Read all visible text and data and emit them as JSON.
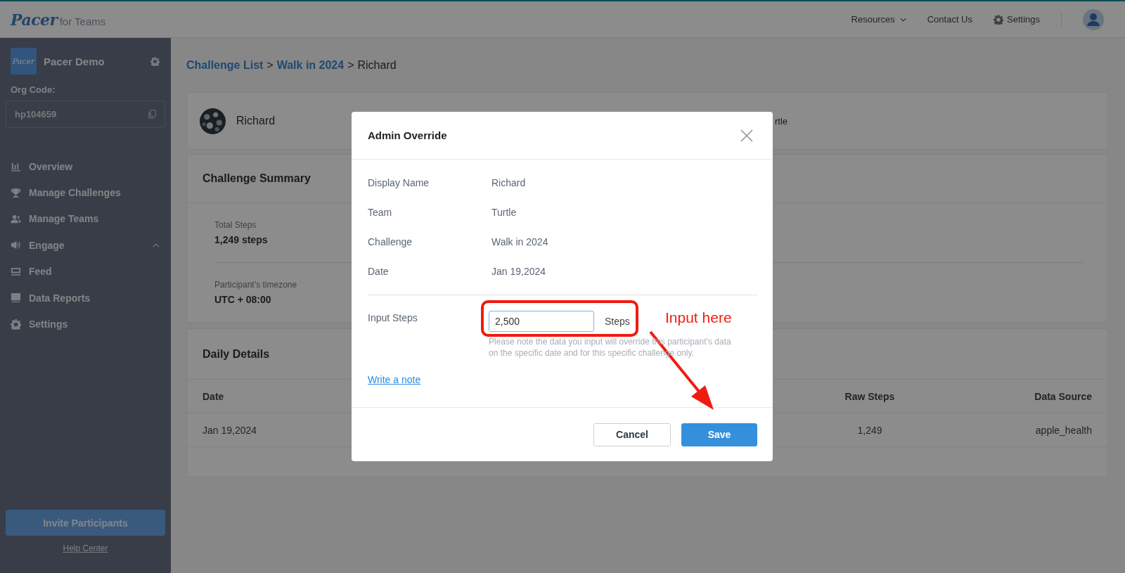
{
  "header": {
    "logo": "Pacer",
    "logo_suffix": "for Teams",
    "nav": [
      {
        "label": "Resources",
        "kind": "dropdown"
      },
      {
        "label": "Contact Us",
        "kind": "link"
      },
      {
        "label": "Settings",
        "kind": "settings"
      }
    ]
  },
  "sidebar": {
    "org_logo": "Pacer",
    "org_name": "Pacer Demo",
    "org_code_label": "Org Code:",
    "org_code": "hp104659",
    "items": [
      {
        "label": "Overview"
      },
      {
        "label": "Manage Challenges"
      },
      {
        "label": "Manage Teams"
      },
      {
        "label": "Engage",
        "expanded": true
      },
      {
        "label": "Feed"
      },
      {
        "label": "Data Reports"
      },
      {
        "label": "Settings"
      }
    ],
    "invite_button": "Invite Participants",
    "help_link": "Help Center"
  },
  "breadcrumb": [
    {
      "text": "Challenge List",
      "kind": "link"
    },
    {
      "text": ">",
      "kind": "separator"
    },
    {
      "text": "Walk in 2024",
      "kind": "link"
    },
    {
      "text": ">",
      "kind": "separator"
    },
    {
      "text": "Richard",
      "kind": "current"
    }
  ],
  "profile": {
    "name": "Richard",
    "team": "rtle"
  },
  "summary": {
    "title": "Challenge Summary",
    "stats": [
      {
        "label": "Total Steps",
        "value": "1,249 steps"
      },
      {
        "label": "Participant’s timezone",
        "value": "UTC + 08:00"
      }
    ]
  },
  "daily": {
    "title": "Daily Details",
    "columns": [
      "Date",
      "Raw Steps",
      "Data Source"
    ],
    "rows": [
      [
        "Jan 19,2024",
        "1,249",
        "apple_health"
      ]
    ]
  },
  "modal": {
    "title": "Admin Override",
    "fields": [
      {
        "label": "Display Name",
        "value": "Richard"
      },
      {
        "label": "Team",
        "value": "Turtle"
      },
      {
        "label": "Challenge",
        "value": "Walk in 2024"
      },
      {
        "label": "Date",
        "value": "Jan 19,2024"
      }
    ],
    "input": {
      "label": "Input Steps",
      "value": "2,500",
      "unit": "Steps",
      "hint": "Please note the data you input will override this participant’s data on the specific date and for this specific challenge only."
    },
    "note_link": "Write a note",
    "buttons": [
      {
        "label": "Cancel",
        "kind": "secondary"
      },
      {
        "label": "Save",
        "kind": "primary"
      }
    ]
  },
  "annotation": {
    "text": "Input here"
  }
}
